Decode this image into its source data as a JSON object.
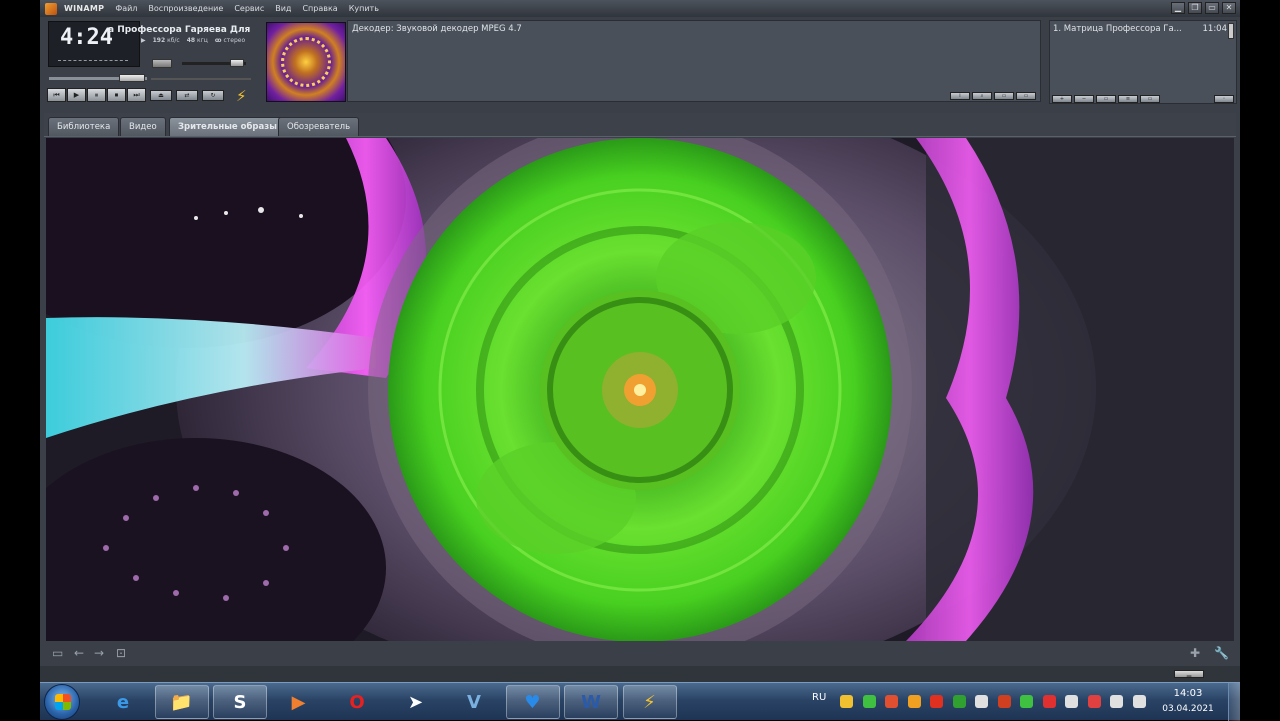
{
  "window": {
    "app_name": "WINAMP",
    "menu": [
      "Файл",
      "Воспроизведение",
      "Сервис",
      "Вид",
      "Справка",
      "Купить"
    ],
    "controls": [
      "▁",
      "❐",
      "▭",
      "✕"
    ]
  },
  "player": {
    "time": "4:24",
    "song_title": "а Профессора Гаряева Для Ле",
    "bitrate": "192",
    "bitrate_unit": "кб/с",
    "samplerate": "48",
    "samplerate_unit": "кгц",
    "mode": "стерео",
    "transport_icons": [
      "⏮",
      "▶",
      "⏸",
      "⏹",
      "⏭"
    ]
  },
  "decoder": {
    "text": "Декодер: Звуковой декодер MPEG 4.7"
  },
  "playlist": {
    "items": [
      {
        "title": "1. Матрица Профессора Га...",
        "duration": "11:04"
      }
    ]
  },
  "tabs": [
    {
      "label": "Библиотека",
      "active": false
    },
    {
      "label": "Видео",
      "active": false
    },
    {
      "label": "Зрительные образы",
      "active": true
    },
    {
      "label": "Обозреватель",
      "active": false
    }
  ],
  "taskbar": {
    "apps": [
      {
        "name": "internet-explorer",
        "glyph": "e",
        "color": "#3a9ae8"
      },
      {
        "name": "file-explorer",
        "glyph": "📁",
        "color": "#e8c050"
      },
      {
        "name": "skype",
        "glyph": "S",
        "color": "#ffffff"
      },
      {
        "name": "media-player",
        "glyph": "▶",
        "color": "#f08030"
      },
      {
        "name": "opera",
        "glyph": "O",
        "color": "#e82020"
      },
      {
        "name": "telegram",
        "glyph": "➤",
        "color": "#ffffff"
      },
      {
        "name": "vpn",
        "glyph": "V",
        "color": "#7ab0e0"
      },
      {
        "name": "heart-app",
        "glyph": "♥",
        "color": "#2a8ae8"
      },
      {
        "name": "word",
        "glyph": "W",
        "color": "#2a5aa8"
      },
      {
        "name": "winamp",
        "glyph": "⚡",
        "color": "#f0c030"
      }
    ],
    "lang": "RU",
    "time": "14:03",
    "date": "03.04.2021"
  },
  "colors": {
    "frame": "#3a3f48",
    "panel": "#4a5059",
    "viz_green": "#5ae020",
    "viz_magenta": "#e040e0",
    "taskbar": "#2a4466"
  }
}
